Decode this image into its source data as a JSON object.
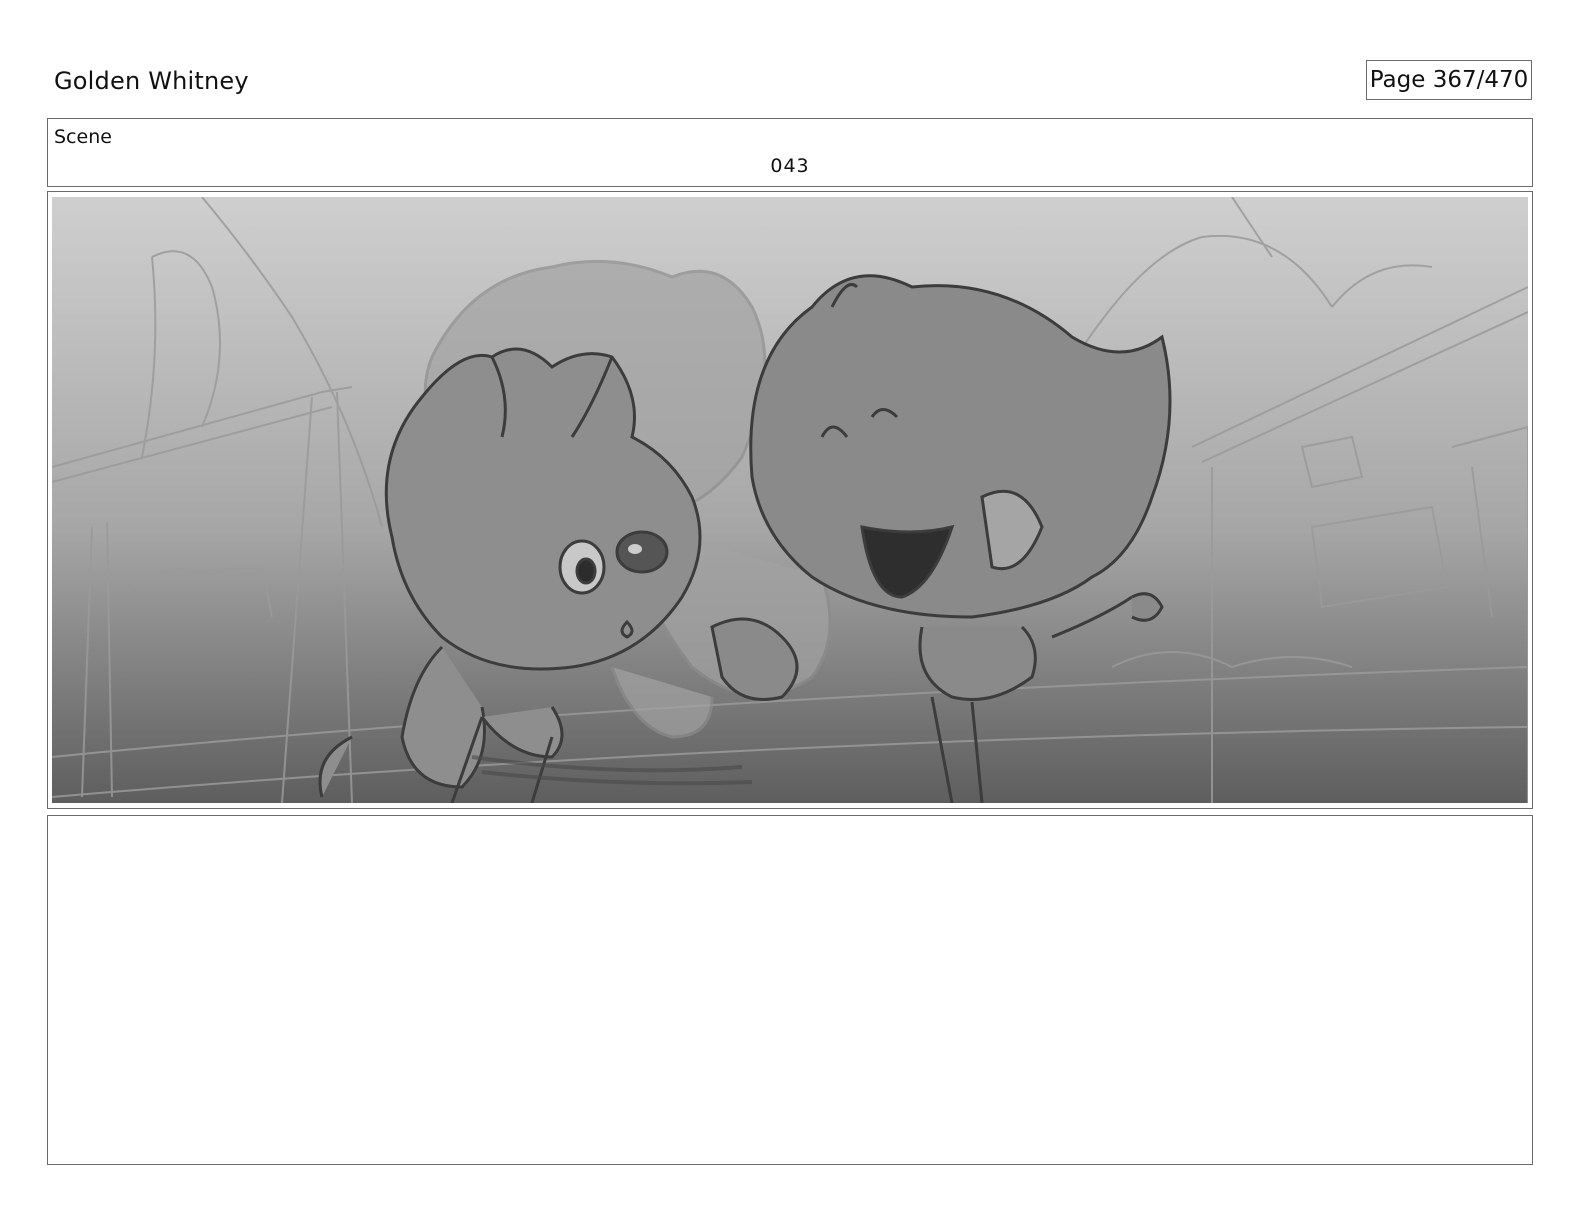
{
  "header": {
    "project_title": "Golden Whitney",
    "page_label": "Page 367/470"
  },
  "scene": {
    "label": "Scene",
    "number": "043"
  },
  "panel": {
    "image_icon": "storyboard-sketch-image",
    "colors": {
      "sky_top": "#cfcfcf",
      "ground_bottom": "#5e5e5e",
      "line_light": "#9a9a9a",
      "line_dark": "#3c3c3c",
      "fill_mid": "#8c8c8c"
    }
  },
  "notes": {
    "text": ""
  }
}
